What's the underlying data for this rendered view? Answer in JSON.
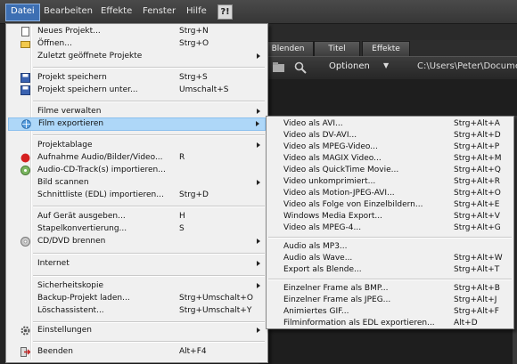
{
  "menubar": {
    "items": [
      "Datei",
      "Bearbeiten",
      "Effekte",
      "Fenster",
      "Hilfe"
    ],
    "help_icon_text": "?!"
  },
  "app": {
    "tabs": [
      "Blenden",
      "Titel",
      "Effekte"
    ],
    "options_label": "Optionen",
    "path": "C:\\Users\\Peter\\Docume"
  },
  "file_menu": {
    "items": [
      {
        "label": "Neues Projekt...",
        "shortcut": "Strg+N",
        "icon": "new-document-icon"
      },
      {
        "label": "Öffnen...",
        "shortcut": "Strg+O",
        "icon": "open-folder-icon"
      },
      {
        "label": "Zuletzt geöffnete Projekte",
        "shortcut": "",
        "submenu": true
      },
      {
        "label": "Projekt speichern",
        "shortcut": "Strg+S",
        "icon": "save-icon"
      },
      {
        "label": "Projekt speichern unter...",
        "shortcut": "Umschalt+S",
        "icon": "save-as-icon"
      },
      {
        "label": "Filme verwalten",
        "shortcut": "",
        "submenu": true
      },
      {
        "label": "Film exportieren",
        "shortcut": "",
        "submenu": true,
        "icon": "globe-export-icon"
      },
      {
        "label": "Projektablage",
        "shortcut": "",
        "submenu": true
      },
      {
        "label": "Aufnahme Audio/Bilder/Video...",
        "shortcut": "R",
        "icon": "record-icon"
      },
      {
        "label": "Audio-CD-Track(s) importieren...",
        "shortcut": "",
        "icon": "audio-cd-icon"
      },
      {
        "label": "Bild scannen",
        "shortcut": "",
        "submenu": true
      },
      {
        "label": "Schnittliste (EDL) importieren...",
        "shortcut": "Strg+D"
      },
      {
        "label": "Auf Gerät ausgeben...",
        "shortcut": "H"
      },
      {
        "label": "Stapelkonvertierung...",
        "shortcut": "S"
      },
      {
        "label": "CD/DVD brennen",
        "shortcut": "",
        "submenu": true,
        "icon": "disc-icon"
      },
      {
        "label": "Internet",
        "shortcut": "",
        "submenu": true
      },
      {
        "label": "Sicherheitskopie",
        "shortcut": "",
        "submenu": true
      },
      {
        "label": "Backup-Projekt laden...",
        "shortcut": "Strg+Umschalt+O"
      },
      {
        "label": "Löschassistent...",
        "shortcut": "Strg+Umschalt+Y"
      },
      {
        "label": "Einstellungen",
        "shortcut": "",
        "submenu": true,
        "icon": "gear-icon"
      },
      {
        "label": "Beenden",
        "shortcut": "Alt+F4",
        "icon": "exit-icon"
      }
    ]
  },
  "export_submenu": {
    "items": [
      {
        "label": "Video als AVI...",
        "shortcut": "Strg+Alt+A"
      },
      {
        "label": "Video als DV-AVI...",
        "shortcut": "Strg+Alt+D"
      },
      {
        "label": "Video als MPEG-Video...",
        "shortcut": "Strg+Alt+P"
      },
      {
        "label": "Video als MAGIX Video...",
        "shortcut": "Strg+Alt+M"
      },
      {
        "label": "Video als QuickTime Movie...",
        "shortcut": "Strg+Alt+Q"
      },
      {
        "label": "Video unkomprimiert...",
        "shortcut": "Strg+Alt+R"
      },
      {
        "label": "Video als Motion-JPEG-AVI...",
        "shortcut": "Strg+Alt+O"
      },
      {
        "label": "Video als Folge von Einzelbildern...",
        "shortcut": "Strg+Alt+E"
      },
      {
        "label": "Windows Media Export...",
        "shortcut": "Strg+Alt+V"
      },
      {
        "label": "Video als MPEG-4...",
        "shortcut": "Strg+Alt+G"
      },
      {
        "label": "Audio als MP3...",
        "shortcut": ""
      },
      {
        "label": "Audio als Wave...",
        "shortcut": "Strg+Alt+W"
      },
      {
        "label": "Export als Blende...",
        "shortcut": "Strg+Alt+T"
      },
      {
        "label": "Einzelner Frame als BMP...",
        "shortcut": "Strg+Alt+B"
      },
      {
        "label": "Einzelner Frame als JPEG...",
        "shortcut": "Strg+Alt+J"
      },
      {
        "label": "Animiertes GIF...",
        "shortcut": "Strg+Alt+F"
      },
      {
        "label": "Filminformation als EDL exportieren...",
        "shortcut": "Alt+D"
      }
    ]
  },
  "colors": {
    "highlight": "#aed7f8",
    "menubar_active": "#3d6fb3",
    "menu_bg": "#f0f0f0"
  }
}
